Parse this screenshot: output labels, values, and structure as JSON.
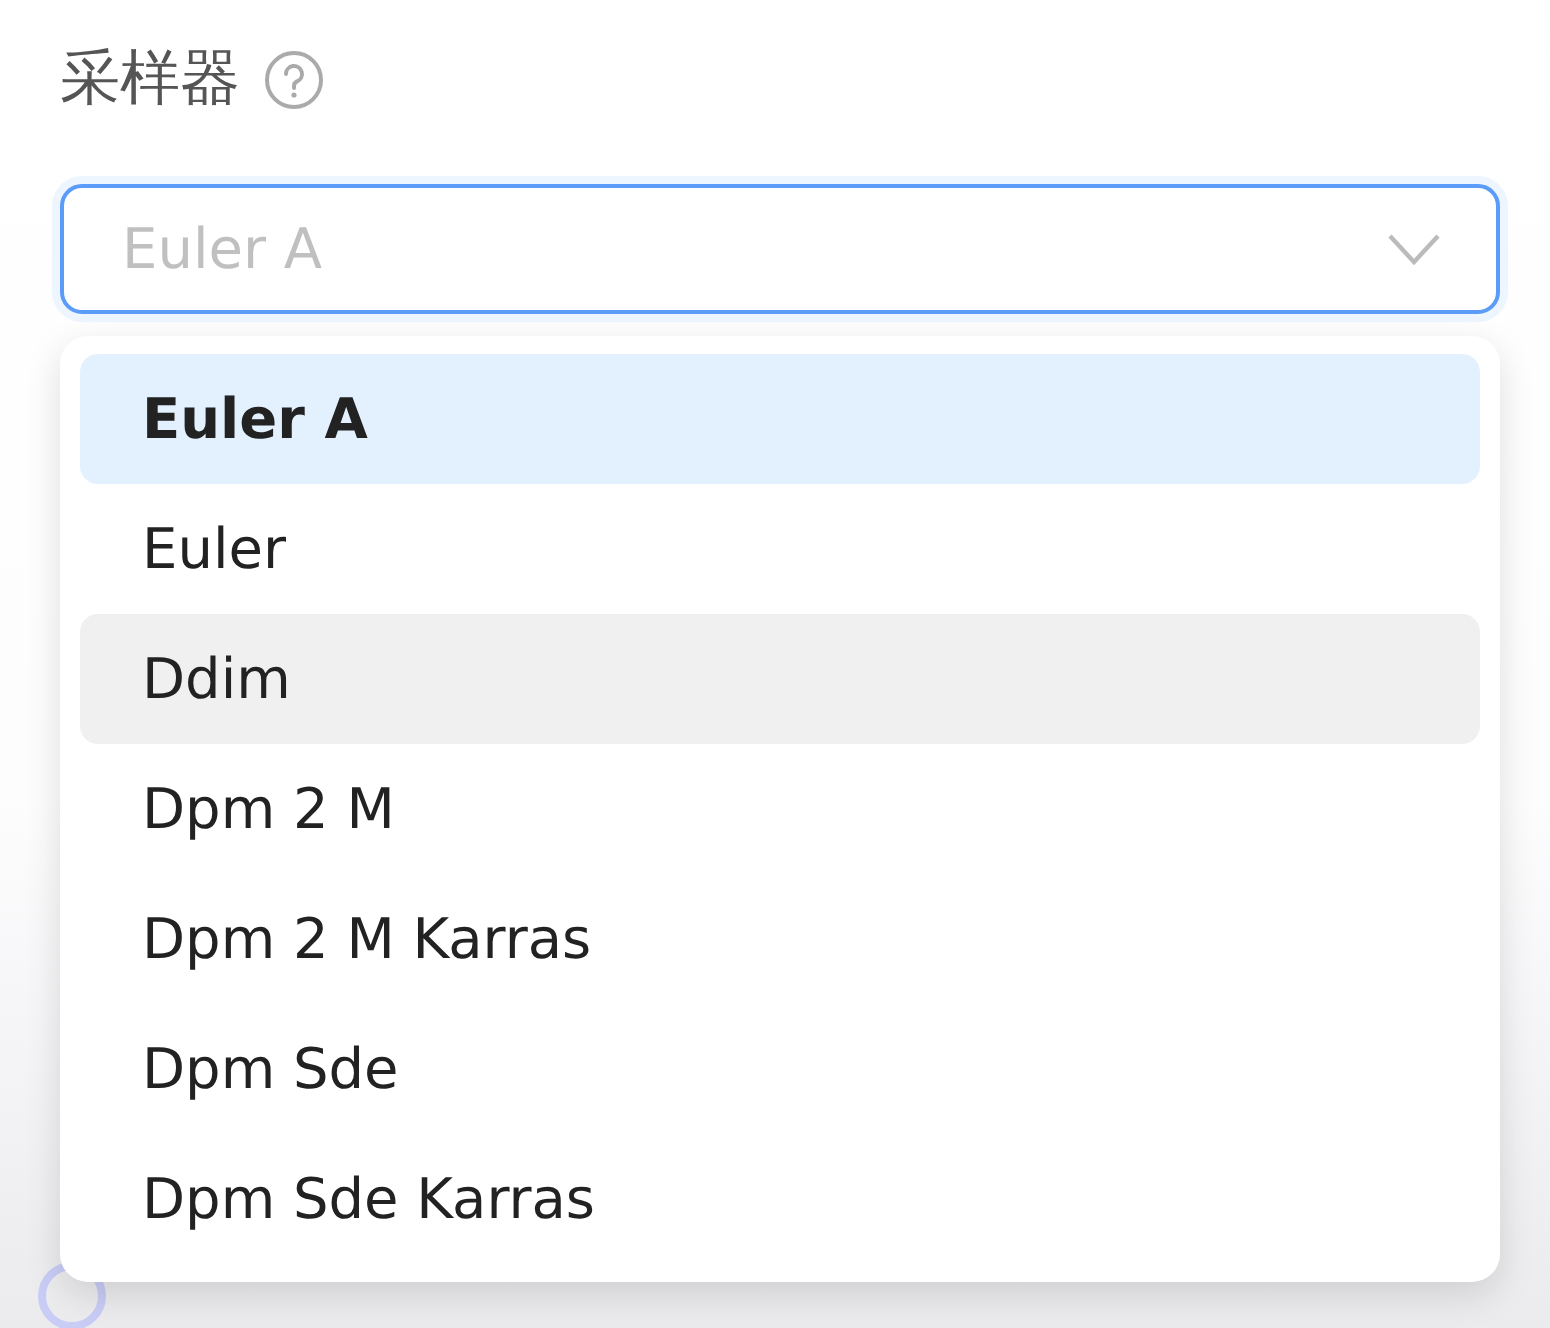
{
  "label": "采样器",
  "select": {
    "value": "Euler A",
    "open": true
  },
  "options": [
    {
      "label": "Euler A",
      "selected": true,
      "hovered": false
    },
    {
      "label": "Euler",
      "selected": false,
      "hovered": false
    },
    {
      "label": "Ddim",
      "selected": false,
      "hovered": true
    },
    {
      "label": "Dpm 2 M",
      "selected": false,
      "hovered": false
    },
    {
      "label": "Dpm 2 M Karras",
      "selected": false,
      "hovered": false
    },
    {
      "label": "Dpm Sde",
      "selected": false,
      "hovered": false
    },
    {
      "label": "Dpm Sde Karras",
      "selected": false,
      "hovered": false
    }
  ]
}
